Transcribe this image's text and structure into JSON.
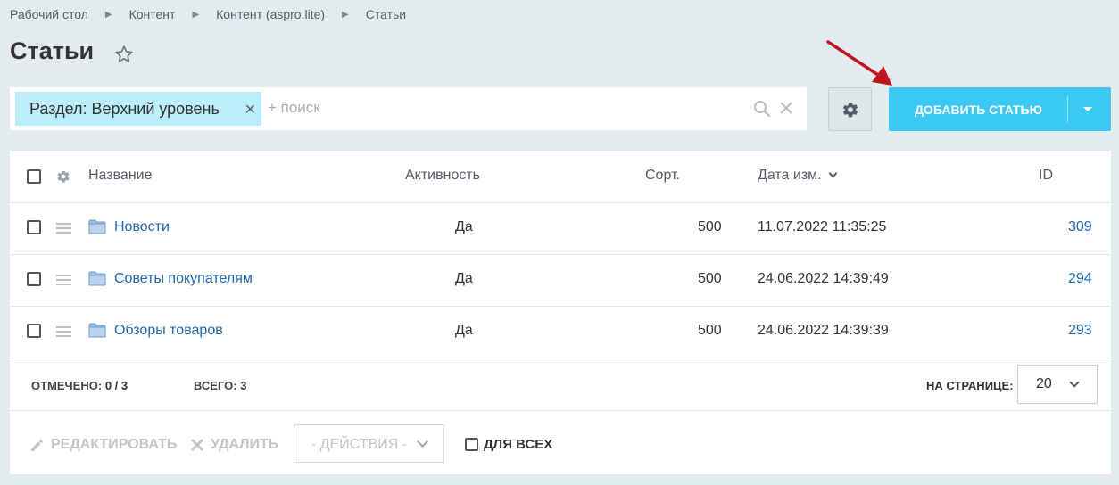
{
  "breadcrumb": [
    "Рабочий стол",
    "Контент",
    "Контент (aspro.lite)",
    "Статьи"
  ],
  "page_title": "Статьи",
  "filter": {
    "tag_label": "Раздел: Верхний уровень",
    "placeholder": "+ поиск"
  },
  "add_button": {
    "label": "ДОБАВИТЬ СТАТЬЮ"
  },
  "columns": {
    "name": "Название",
    "active": "Активность",
    "sort": "Сорт.",
    "date": "Дата изм.",
    "id": "ID"
  },
  "rows": [
    {
      "name": "Новости",
      "active": "Да",
      "sort": "500",
      "date": "11.07.2022 11:35:25",
      "id": "309"
    },
    {
      "name": "Советы покупателям",
      "active": "Да",
      "sort": "500",
      "date": "24.06.2022 14:39:49",
      "id": "294"
    },
    {
      "name": "Обзоры товаров",
      "active": "Да",
      "sort": "500",
      "date": "24.06.2022 14:39:39",
      "id": "293"
    }
  ],
  "footer": {
    "selected_label": "ОТМЕЧЕНО:",
    "selected_value": "0 / 3",
    "total_label": "ВСЕГО:",
    "total_value": "3",
    "per_page_label": "НА СТРАНИЦЕ:",
    "per_page_value": "20"
  },
  "actions": {
    "edit": "РЕДАКТИРОВАТЬ",
    "delete": "УДАЛИТЬ",
    "dropdown": "- ДЕЙСТВИЯ -",
    "for_all": "ДЛЯ ВСЕХ"
  },
  "colors": {
    "accent": "#3bc8f5",
    "link": "#2067b0",
    "tag_bg": "#bcedfc",
    "arrow": "#c0141e"
  }
}
